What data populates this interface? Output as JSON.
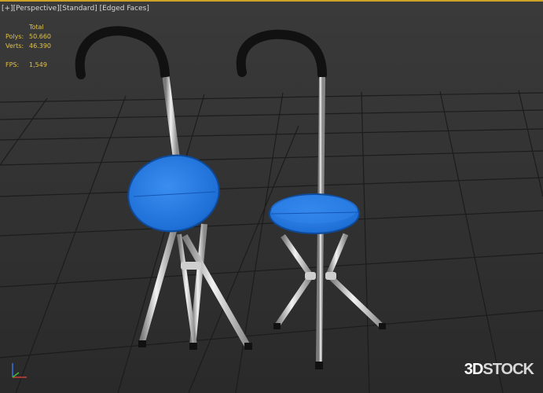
{
  "viewport": {
    "label": {
      "plus": "[+]",
      "view": "[Perspective]",
      "shading": "[Standard]",
      "edges": "[Edged Faces]"
    },
    "stats": {
      "header": "Total",
      "polys_label": "Polys:",
      "polys_value": "50.660",
      "verts_label": "Verts:",
      "verts_value": "46.390",
      "fps_label": "FPS:",
      "fps_value": "1,549"
    },
    "watermark_part1": "3D",
    "watermark_part2": "STOCK"
  },
  "colors": {
    "accent_line": "#c9a227",
    "stats_text": "#e0c34a",
    "seat_blue": "#1e6fd6",
    "handle_black": "#111111",
    "grid": "#1a1a1a"
  }
}
